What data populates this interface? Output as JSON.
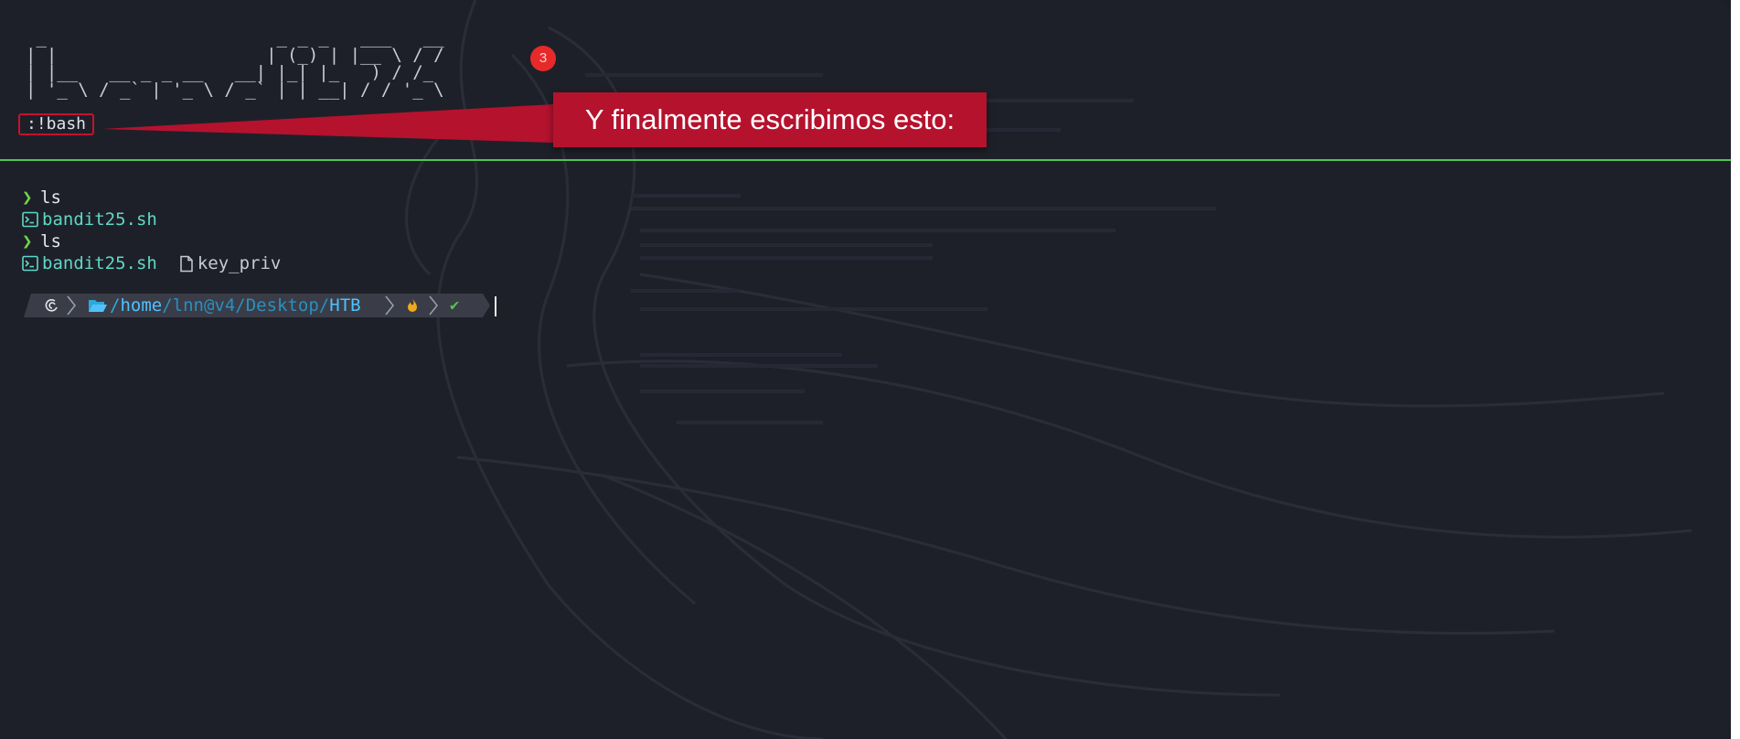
{
  "banner": {
    "ascii_lines": [
      " _                      _ _ _   ___   __",
      "| |                    | (_) | |__ \\ / /",
      "| |__   __ _ _ __   __| |_| |_   ) / /_",
      "| '_ \\ / _` | '_ \\ / _` | | __| / / '_ \\"
    ]
  },
  "vim_command": ":!bash",
  "annotation": {
    "step_number": "3",
    "text": "Y finalmente escribimos esto:"
  },
  "terminal": {
    "lines": [
      {
        "type": "command",
        "prompt": "❯",
        "text": "ls"
      },
      {
        "type": "output",
        "files": [
          {
            "name": "bandit25.sh",
            "icon": "terminal-file-icon"
          }
        ]
      },
      {
        "type": "command",
        "prompt": "❯",
        "text": "ls"
      },
      {
        "type": "output",
        "files": [
          {
            "name": "bandit25.sh",
            "icon": "terminal-file-icon"
          },
          {
            "name": "key_priv",
            "icon": "document-file-icon"
          }
        ]
      }
    ],
    "prompt_segments": {
      "os_icon": "debian-swirl-icon",
      "folder_icon": "folder-open-icon",
      "path_slash": "/",
      "path_home": "home",
      "path_middle": "/lnn@v4/Desktop/",
      "path_last": "HTB",
      "status_icon": "fire-icon",
      "success_icon": "checkmark-icon",
      "success_glyph": "✔"
    }
  },
  "colors": {
    "background": "#1e2029",
    "callout": "#b5122e",
    "divider": "#4fc45a",
    "prompt_caret": "#6cd64a",
    "path": "#4fc1ff"
  }
}
